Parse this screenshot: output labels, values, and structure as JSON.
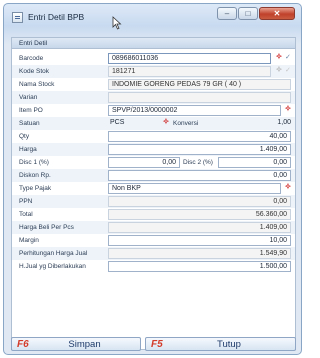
{
  "window": {
    "title": "Entri Detil BPB"
  },
  "panel": {
    "title": "Entri Detil"
  },
  "fields": {
    "barcode": {
      "label": "Barcode",
      "value": "089686011036"
    },
    "kode_stok": {
      "label": "Kode Stok",
      "value": "181271"
    },
    "nama_stock": {
      "label": "Nama Stock",
      "value": "INDOMIE GORENG PEDAS 79 GR ( 40 )"
    },
    "varian": {
      "label": "Varian",
      "value": ""
    },
    "item_po": {
      "label": "Item PO",
      "value": "SPVP/2013/0000002"
    },
    "satuan": {
      "label": "Satuan",
      "value": "PCS",
      "konversi_label": "Konversi",
      "konversi_value": "1,00"
    },
    "qty": {
      "label": "Qty",
      "value": "40,00"
    },
    "harga": {
      "label": "Harga",
      "value": "1.409,00"
    },
    "disc1": {
      "label": "Disc 1 (%)",
      "value": "0,00",
      "disc2_label": "Disc 2 (%)",
      "disc2_value": "0,00"
    },
    "diskon_rp": {
      "label": "Diskon Rp.",
      "value": "0,00"
    },
    "type_pajak": {
      "label": "Type Pajak",
      "value": "Non BKP"
    },
    "ppn": {
      "label": "PPN",
      "value": "0,00"
    },
    "total": {
      "label": "Total",
      "value": "56.360,00"
    },
    "harga_beli_per_pcs": {
      "label": "Harga Beli Per Pcs",
      "value": "1.409,00"
    },
    "margin": {
      "label": "Margin",
      "value": "10,00"
    },
    "perhitungan_harga_jual": {
      "label": "Perhitungan Harga Jual",
      "value": "1.549,90"
    },
    "hjual_diberlakukan": {
      "label": "H.Jual yg Diberlakukan",
      "value": "1.500,00"
    }
  },
  "buttons": {
    "simpan": {
      "key": "F6",
      "label": "Simpan"
    },
    "tutup": {
      "key": "F5",
      "label": "Tutup"
    }
  },
  "icons": {
    "lookup": "red-puzzle-icon",
    "check": "checkmark-icon"
  }
}
